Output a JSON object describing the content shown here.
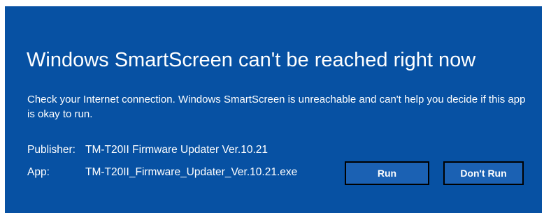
{
  "dialog": {
    "title": "Windows SmartScreen can't be reached right now",
    "message": "Check your Internet connection. Windows SmartScreen is unreachable and can't help you decide if this app is okay to run.",
    "publisher_label": "Publisher:",
    "publisher_value": "TM-T20II Firmware Updater Ver.10.21",
    "app_label": "App:",
    "app_value": "TM-T20II_Firmware_Updater_Ver.10.21.exe",
    "run_label": "Run",
    "dont_run_label": "Don't Run"
  },
  "colors": {
    "background": "#0751a3",
    "button": "#1b61b3",
    "button_border": "#000000",
    "text": "#ffffff"
  }
}
